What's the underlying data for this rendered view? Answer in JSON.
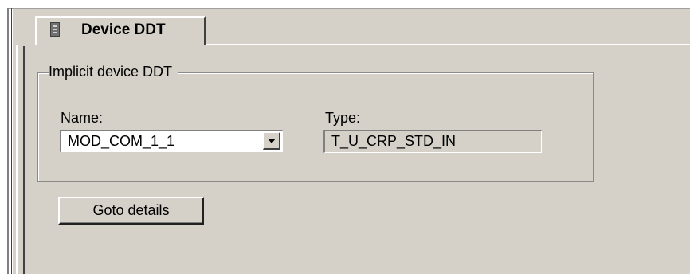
{
  "tab": {
    "label": "Device DDT",
    "icon": "device-icon"
  },
  "group": {
    "legend": "Implicit device DDT"
  },
  "name_field": {
    "label": "Name:",
    "value": "MOD_COM_1_1"
  },
  "type_field": {
    "label": "Type:",
    "value": "T_U_CRP_STD_IN"
  },
  "buttons": {
    "goto_details": "Goto details"
  },
  "colors": {
    "panel_bg": "#d5d1c8",
    "shadow": "#808080",
    "highlight": "#ffffff"
  }
}
